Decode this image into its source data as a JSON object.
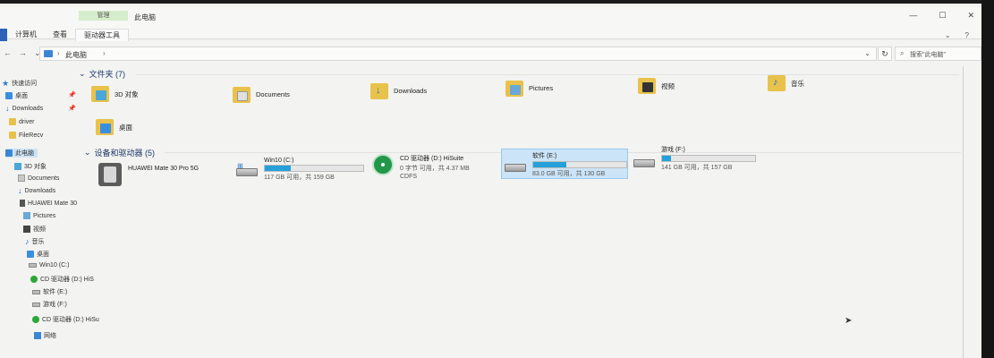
{
  "window": {
    "context_tab": "管理",
    "title": "此电脑",
    "controls": [
      "—",
      "☐",
      "✕"
    ]
  },
  "ribbon": {
    "tabs": [
      "计算机",
      "查看",
      "驱动器工具"
    ],
    "right": [
      "⌄",
      "?"
    ]
  },
  "address": {
    "back": "←",
    "forward": "→",
    "recent": "⌄",
    "up": "↑",
    "sep": "›",
    "path": "此电脑",
    "dropdown": "⌄",
    "refresh": "↻",
    "search_icon": "⌕",
    "search_placeholder": "搜索\"此电脑\""
  },
  "nav_pane": {
    "quick_access": "快速访问",
    "pin": "📌",
    "items": [
      "桌面",
      "Downloads",
      "driver",
      "FileRecv",
      "此电脑",
      "3D 对象",
      "Documents",
      "Downloads",
      "HUAWEI Mate 30",
      "Pictures",
      "视频",
      "音乐",
      "桌面",
      "Win10 (C:)",
      "CD 驱动器 (D:) HiS",
      "软件 (E:)",
      "游戏 (F:)",
      "CD 驱动器 (D:) HiSu",
      "网络"
    ]
  },
  "folders": {
    "header": "文件夹 (7)",
    "items": [
      "3D 对象",
      "Documents",
      "Downloads",
      "Pictures",
      "视频",
      "音乐",
      "桌面"
    ]
  },
  "devices": {
    "header": "设备和驱动器 (5)",
    "items": [
      {
        "name": "HUAWEI Mate 30 Pro 5G"
      },
      {
        "name": "Win10 (C:)",
        "sub": "117 GB 可用，共 159 GB",
        "used_fraction": 0.26
      },
      {
        "name": "CD 驱动器 (D:) HiSuite",
        "sub": "0 字节 可用，共 4.37 MB",
        "fs": "CDFS"
      },
      {
        "name": "软件 (E:)",
        "sub": "83.0 GB 可用，共 130 GB",
        "used_fraction": 0.36
      },
      {
        "name": "游戏 (F:)",
        "sub": "141 GB 可用，共 157 GB",
        "used_fraction": 0.1
      }
    ]
  },
  "colors": {
    "accent": "#26a0da",
    "selection": "#cce4f7",
    "folder": "#e8c24b"
  }
}
